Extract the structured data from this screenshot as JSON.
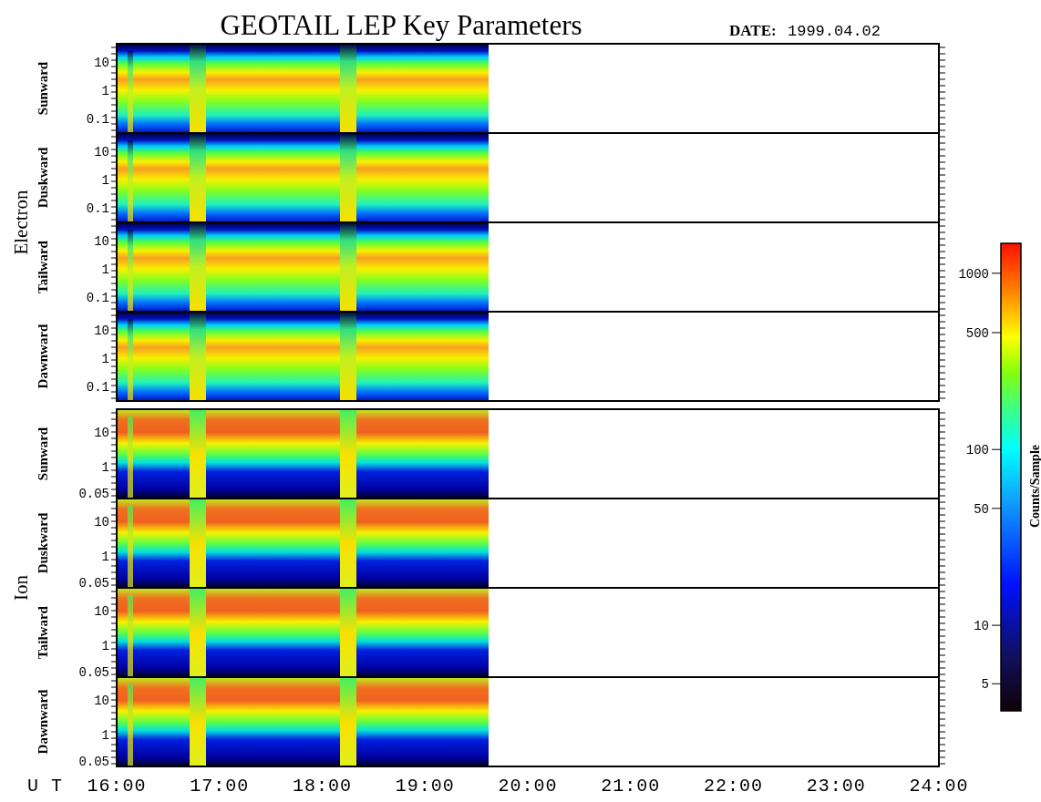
{
  "title": "GEOTAIL LEP Key Parameters",
  "date_label": "DATE:",
  "date": "1999.04.02",
  "groups": [
    {
      "label": "Electron",
      "panels": [
        {
          "label": "Sunward",
          "yticks": [
            "10",
            "1",
            "0.1"
          ]
        },
        {
          "label": "Duskward",
          "yticks": [
            "10",
            "1",
            "0.1"
          ]
        },
        {
          "label": "Tailward",
          "yticks": [
            "10",
            "1",
            "0.1"
          ]
        },
        {
          "label": "Dawnward",
          "yticks": [
            "10",
            "1",
            "0.1"
          ]
        }
      ]
    },
    {
      "label": "Ion",
      "panels": [
        {
          "label": "Sunward",
          "yticks": [
            "10",
            "1",
            "0.05"
          ]
        },
        {
          "label": "Duskward",
          "yticks": [
            "10",
            "1",
            "0.05"
          ]
        },
        {
          "label": "Tailward",
          "yticks": [
            "10",
            "1",
            "0.05"
          ]
        },
        {
          "label": "Dawnward",
          "yticks": [
            "10",
            "1",
            "0.05"
          ]
        }
      ]
    }
  ],
  "time_axis": {
    "label": "U T",
    "ticks": [
      "16:00",
      "17:00",
      "18:00",
      "19:00",
      "20:00",
      "21:00",
      "22:00",
      "23:00",
      "24:00"
    ]
  },
  "colorbar": {
    "title": "Counts/Sample",
    "ticks": [
      "1000",
      "500",
      "100",
      "50",
      "10",
      "5"
    ]
  }
}
